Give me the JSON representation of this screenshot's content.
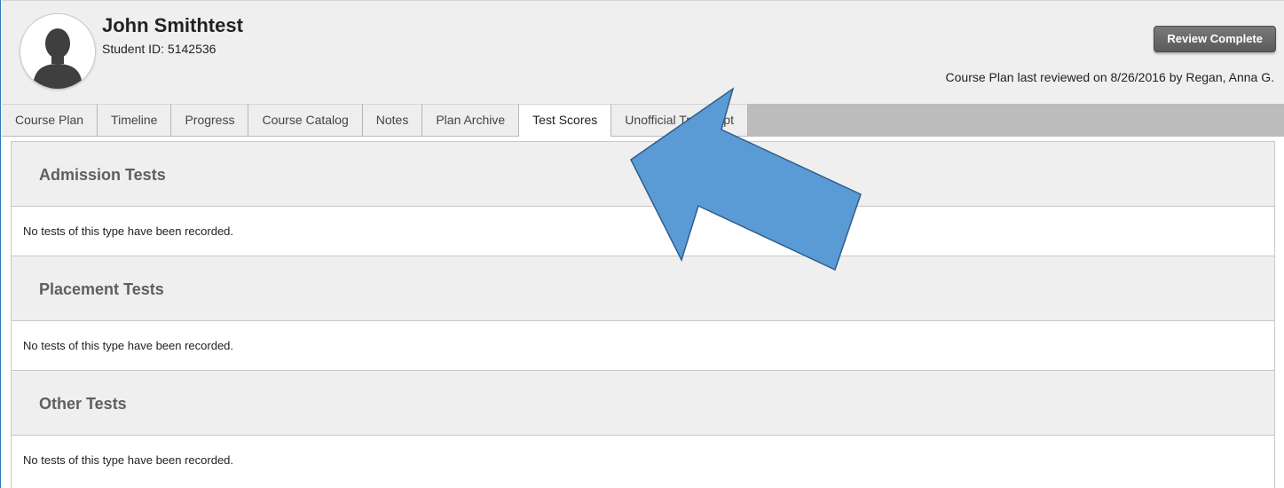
{
  "header": {
    "student_name": "John Smithtest",
    "student_id_line": "Student ID: 5142536",
    "review_button_label": "Review Complete",
    "last_reviewed": "Course Plan last reviewed on 8/26/2016 by Regan, Anna G."
  },
  "tabs": [
    {
      "label": "Course Plan",
      "active": false
    },
    {
      "label": "Timeline",
      "active": false
    },
    {
      "label": "Progress",
      "active": false
    },
    {
      "label": "Course Catalog",
      "active": false
    },
    {
      "label": "Notes",
      "active": false
    },
    {
      "label": "Plan Archive",
      "active": false
    },
    {
      "label": "Test Scores",
      "active": true
    },
    {
      "label": "Unofficial Transcript",
      "active": false
    }
  ],
  "sections": [
    {
      "title": "Admission Tests",
      "message": "No tests of this type have been recorded."
    },
    {
      "title": "Placement Tests",
      "message": "No tests of this type have been recorded."
    },
    {
      "title": "Other Tests",
      "message": "No tests of this type have been recorded."
    }
  ],
  "icons": {
    "avatar": "person-silhouette-icon",
    "annotation": "arrow-icon"
  },
  "colors": {
    "header_bg": "#efefef",
    "tabbar_bg": "#bcbcbc",
    "section_header_text": "#5f5f5f",
    "button_bg": "#6b6b6b",
    "arrow_fill": "#5b9bd5",
    "arrow_stroke": "#2f5d8c"
  }
}
